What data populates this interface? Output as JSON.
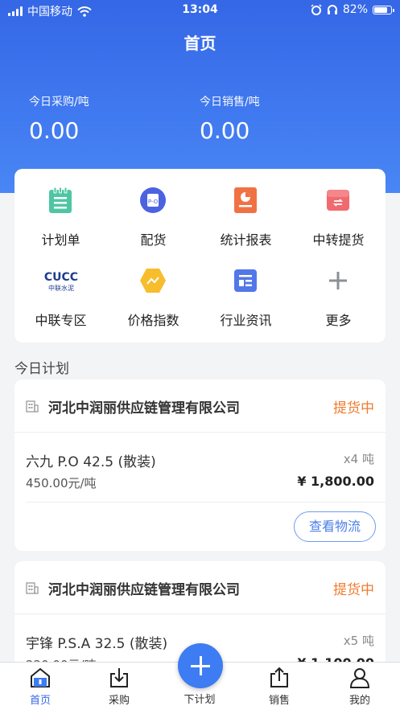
{
  "status_bar": {
    "carrier": "中国移动",
    "time": "13:04",
    "battery": "82%"
  },
  "header": {
    "title": "首页"
  },
  "stats": [
    {
      "label": "今日采购/吨",
      "value": "0.00"
    },
    {
      "label": "今日销售/吨",
      "value": "0.00"
    }
  ],
  "grid": [
    {
      "label": "计划单",
      "icon": "plan-list-icon"
    },
    {
      "label": "配货",
      "icon": "allocation-icon"
    },
    {
      "label": "统计报表",
      "icon": "report-icon"
    },
    {
      "label": "中转提货",
      "icon": "transfer-pickup-icon"
    },
    {
      "label": "中联专区",
      "icon": "cucc-logo-icon",
      "logo_text": "CUCC",
      "logo_sub": "中联水泥"
    },
    {
      "label": "价格指数",
      "icon": "price-index-icon"
    },
    {
      "label": "行业资讯",
      "icon": "news-icon"
    },
    {
      "label": "更多",
      "icon": "plus-icon"
    }
  ],
  "section_title": "今日计划",
  "orders": [
    {
      "company": "河北中润丽供应链管理有限公司",
      "status": "提货中",
      "product": "六九 P.O 42.5 (散装)",
      "qty": "x4 吨",
      "price": "450.00元/吨",
      "total": "¥ 1,800.00",
      "logistics_label": "查看物流"
    },
    {
      "company": "河北中润丽供应链管理有限公司",
      "status": "提货中",
      "product": "宇锋 P.S.A 32.5 (散装)",
      "qty": "x5 吨",
      "price": "220.00元/吨",
      "total": "¥ 1,100.00"
    }
  ],
  "tabbar": [
    {
      "label": "首页",
      "icon": "home-icon"
    },
    {
      "label": "采购",
      "icon": "purchase-icon"
    },
    {
      "label": "下计划",
      "icon": "add-plan-icon"
    },
    {
      "label": "销售",
      "icon": "sales-icon"
    },
    {
      "label": "我的",
      "icon": "profile-icon"
    }
  ],
  "colors": {
    "primary": "#3567e6",
    "status_orange": "#f07a2c"
  }
}
